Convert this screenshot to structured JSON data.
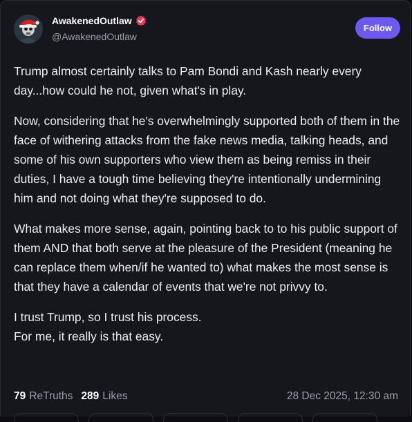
{
  "post": {
    "author_name": "AwakenedOutlaw",
    "author_handle": "@AwakenedOutlaw",
    "follow_label": "Follow",
    "paragraphs": [
      "Trump almost certainly talks to Pam Bondi and Kash nearly every day...how could he not, given what's in play.",
      "Now, considering that he's overwhelmingly supported both of them in the face of withering attacks from the fake news media, talking heads, and some of his own supporters who view them as being remiss in their duties, I have a tough time believing they're intentionally undermining him and not doing what they're supposed to do.",
      "What makes more sense, again, pointing back to to his public support of them AND that both serve at the pleasure of the President (meaning he can replace them when/if he wanted to) what makes the most sense is that they have a calendar of events that we're not privvy to.",
      "I trust Trump, so I trust his process.\nFor me, it really is that easy."
    ],
    "retruths_count": "79",
    "retruths_label": "ReTruths",
    "likes_count": "289",
    "likes_label": "Likes",
    "timestamp": "28 Dec 2025, 12:30 am"
  },
  "colors": {
    "accent": "#6b59f0",
    "verified_badge": "#e23d52",
    "background": "#16161d"
  },
  "icons": {
    "avatar": "skull-santa-hat-avatar",
    "verified": "verified-badge-icon"
  }
}
